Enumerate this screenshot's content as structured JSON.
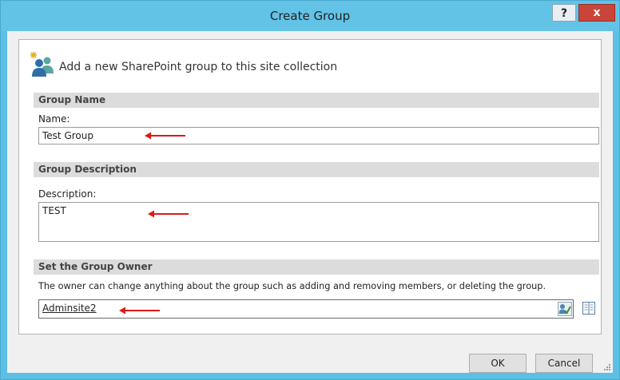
{
  "window": {
    "title": "Create Group",
    "help_label": "?",
    "close_label": "x"
  },
  "header": {
    "text": "Add a new SharePoint group to this site collection",
    "icon": "people-group-add-icon"
  },
  "group_name": {
    "section_title": "Group Name",
    "label": "Name:",
    "value": "Test Group"
  },
  "group_description": {
    "section_title": "Group Description",
    "label": "Description:",
    "value": "TEST"
  },
  "group_owner": {
    "section_title": "Set the Group Owner",
    "help_text": "The owner can change anything about the group such as adding and removing members, or deleting the group.",
    "value": "Adminsite2",
    "check_names_icon": "check-names-icon",
    "browse_icon": "address-book-icon"
  },
  "buttons": {
    "ok": "OK",
    "cancel": "Cancel"
  },
  "colors": {
    "titlebar": "#62c3e6",
    "close_button": "#c9453a",
    "annotation_arrow": "#e01818"
  }
}
